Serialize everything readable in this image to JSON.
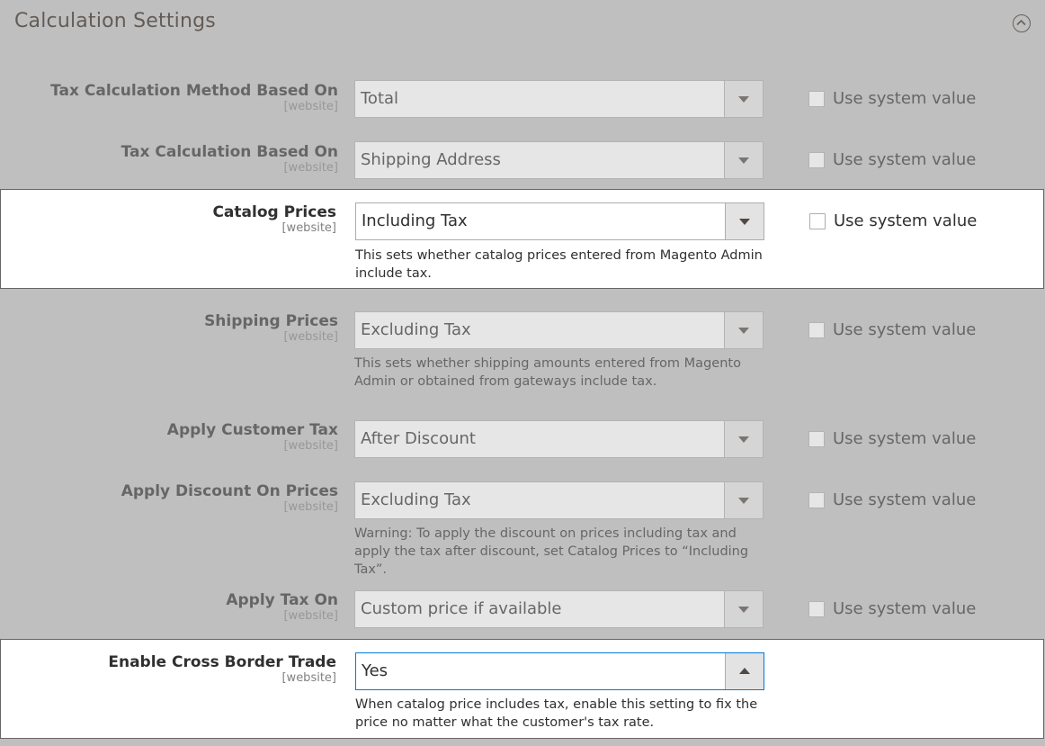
{
  "section": {
    "title": "Calculation Settings",
    "collapse_icon": "chevron-up-circle-icon"
  },
  "rows": [
    {
      "label": "Tax Calculation Method Based On",
      "scope": "[website]",
      "value": "Total",
      "use_system": "Use system value",
      "note": ""
    },
    {
      "label": "Tax Calculation Based On",
      "scope": "[website]",
      "value": "Shipping Address",
      "use_system": "Use system value",
      "note": ""
    },
    {
      "label": "Catalog Prices",
      "scope": "[website]",
      "value": "Including Tax",
      "use_system": "Use system value",
      "note": "This sets whether catalog prices entered from Magento Admin include tax."
    },
    {
      "label": "Shipping Prices",
      "scope": "[website]",
      "value": "Excluding Tax",
      "use_system": "Use system value",
      "note": "This sets whether shipping amounts entered from Magento Admin or obtained from gateways include tax."
    },
    {
      "label": "Apply Customer Tax",
      "scope": "[website]",
      "value": "After Discount",
      "use_system": "Use system value",
      "note": ""
    },
    {
      "label": "Apply Discount On Prices",
      "scope": "[website]",
      "value": "Excluding Tax",
      "use_system": "Use system value",
      "note": "Warning: To apply the discount on prices including tax and apply the tax after discount, set Catalog Prices to “Including Tax”."
    },
    {
      "label": "Apply Tax On",
      "scope": "[website]",
      "value": "Custom price if available",
      "use_system": "Use system value",
      "note": ""
    },
    {
      "label": "Enable Cross Border Trade",
      "scope": "[website]",
      "value": "Yes",
      "use_system": "",
      "note": "When catalog price includes tax, enable this setting to fix the price no matter what the customer's tax rate."
    }
  ],
  "colors": {
    "overlay": "#bfbfbf",
    "highlight": "#ffffff",
    "focus_border": "#007bdb"
  }
}
